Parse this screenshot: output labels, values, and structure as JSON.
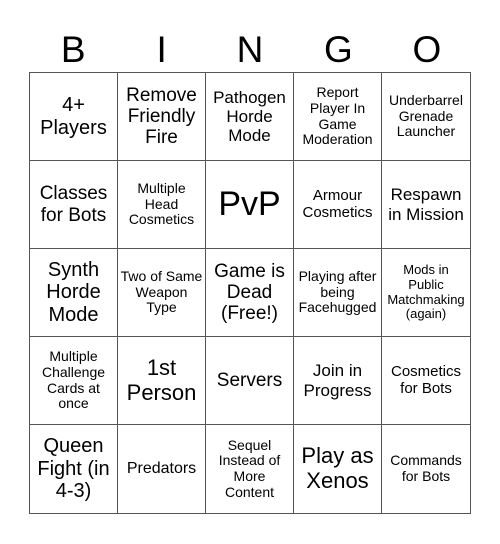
{
  "header": [
    "B",
    "I",
    "N",
    "G",
    "O"
  ],
  "cells": [
    [
      "4+ Players",
      "Remove Friendly Fire",
      "Pathogen Horde Mode",
      "Report Player In Game Moderation",
      "Underbarrel Grenade Launcher"
    ],
    [
      "Classes for Bots",
      "Multiple Head Cosmetics",
      "PvP",
      "Armour Cosmetics",
      "Respawn in Mission"
    ],
    [
      "Synth Horde Mode",
      "Two of Same Weapon Type",
      "Game is Dead (Free!)",
      "Playing after being Facehugged",
      "Mods in Public Matchmaking (again)"
    ],
    [
      "Multiple Challenge Cards at once",
      "1st Person",
      "Servers",
      "Join in Progress",
      "Cosmetics for Bots"
    ],
    [
      "Queen Fight (in 4-3)",
      "Predators",
      "Sequel Instead of More Content",
      "Play as Xenos",
      "Commands for Bots"
    ]
  ]
}
